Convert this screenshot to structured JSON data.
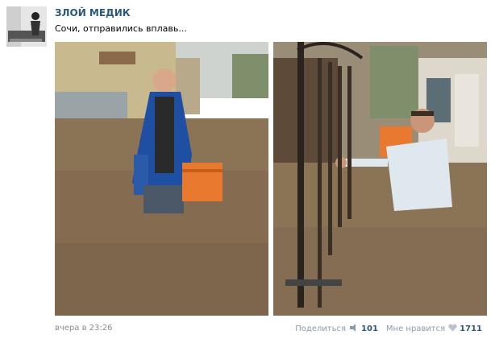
{
  "post": {
    "author": "ЗЛОЙ МЕДИК",
    "text": "Сочи, отправились вплавь...",
    "timestamp": "вчера в 23:26"
  },
  "actions": {
    "share_label": "Поделиться",
    "share_count": "101",
    "like_label": "Мне нравится",
    "like_count": "1711"
  },
  "colors": {
    "link": "#2b587a",
    "muted": "#8c8c8c",
    "flood_water": "#8b7355",
    "jacket": "#1f4fa3",
    "case": "#e8792e"
  }
}
